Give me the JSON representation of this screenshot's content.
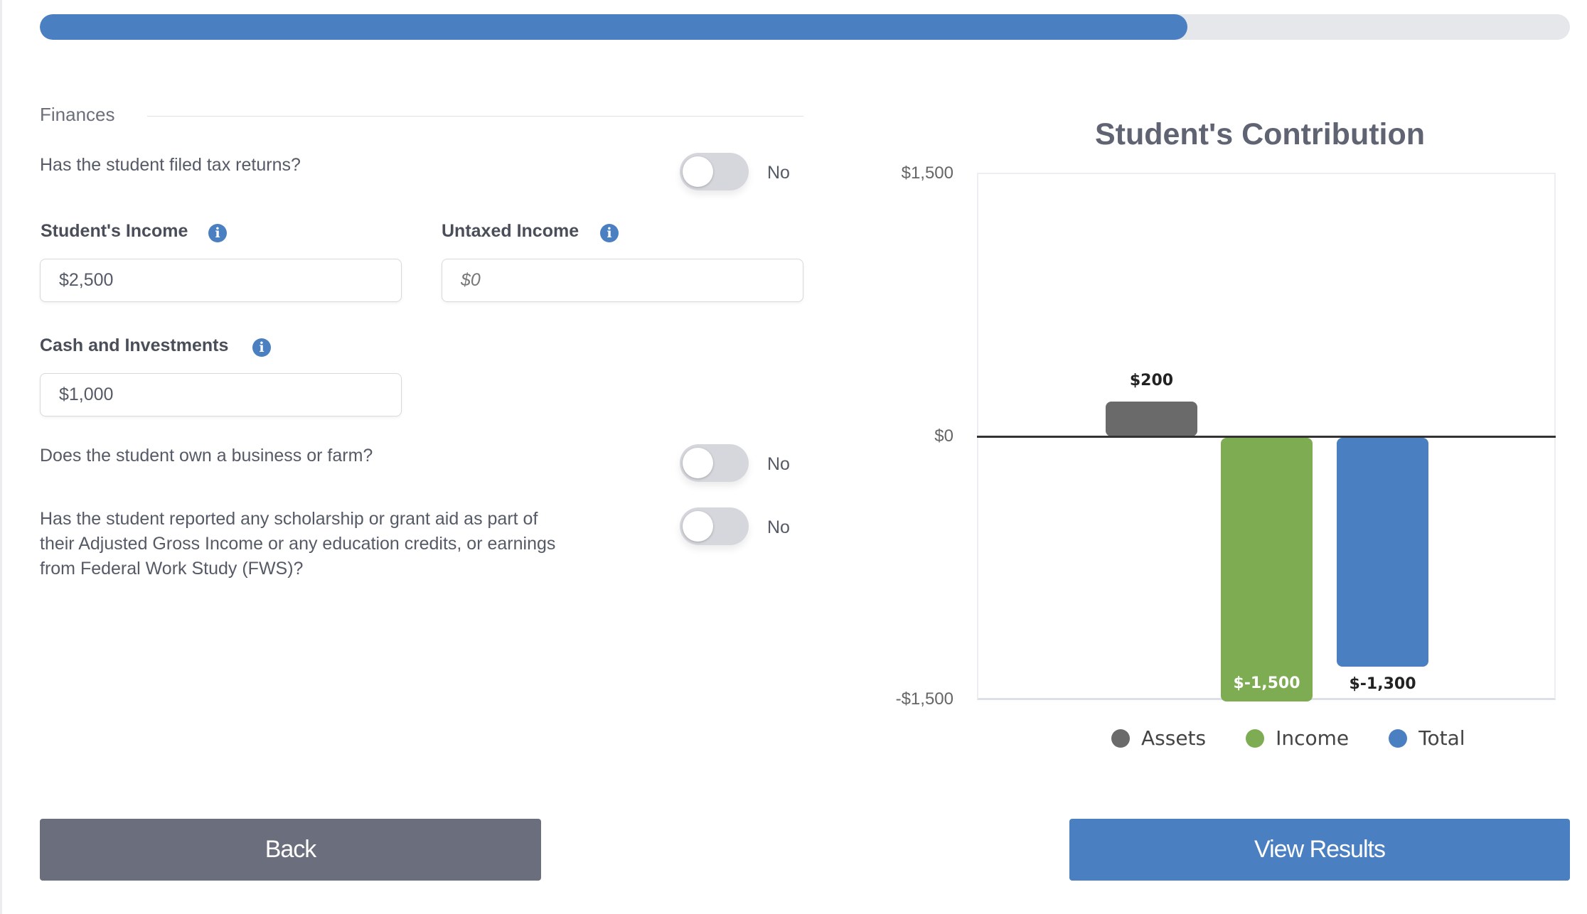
{
  "progress": {
    "fraction": 0.75,
    "color": "#4a7fc1"
  },
  "section": {
    "title": "Finances"
  },
  "questions": {
    "tax_returns": {
      "text": "Has the student filed tax returns?",
      "value": "No"
    },
    "business": {
      "text": "Does the student own a business or farm?",
      "value": "No"
    },
    "scholarship": {
      "line1": "Has the student reported any scholarship or grant aid as part of",
      "line2": "their Adjusted Gross Income or any education credits, or earnings",
      "line3": "from Federal Work Study (FWS)?",
      "value": "No"
    }
  },
  "fields": {
    "student_income": {
      "label": "Student's Income",
      "value": "$2,500"
    },
    "untaxed_income": {
      "label": "Untaxed Income",
      "placeholder": "$0"
    },
    "cash": {
      "label": "Cash and Investments",
      "value": "$1,000"
    }
  },
  "icons": {
    "info": "i"
  },
  "chart_data": {
    "type": "bar",
    "title": "Student's Contribution",
    "categories": [
      "Assets",
      "Income",
      "Total"
    ],
    "values": [
      200,
      -1500,
      -1300
    ],
    "data_labels": [
      "$200",
      "$-1,500",
      "$-1,300"
    ],
    "colors": [
      "#6a6a6a",
      "#7dac52",
      "#4a7fc1"
    ],
    "ylim": [
      -1500,
      1500
    ],
    "yticks": [
      "$1,500",
      "$0",
      "-$1,500"
    ],
    "legend": [
      "Assets",
      "Income",
      "Total"
    ],
    "legend_position": "bottom",
    "grid": false
  },
  "buttons": {
    "back": "Back",
    "view_results": "View Results"
  }
}
